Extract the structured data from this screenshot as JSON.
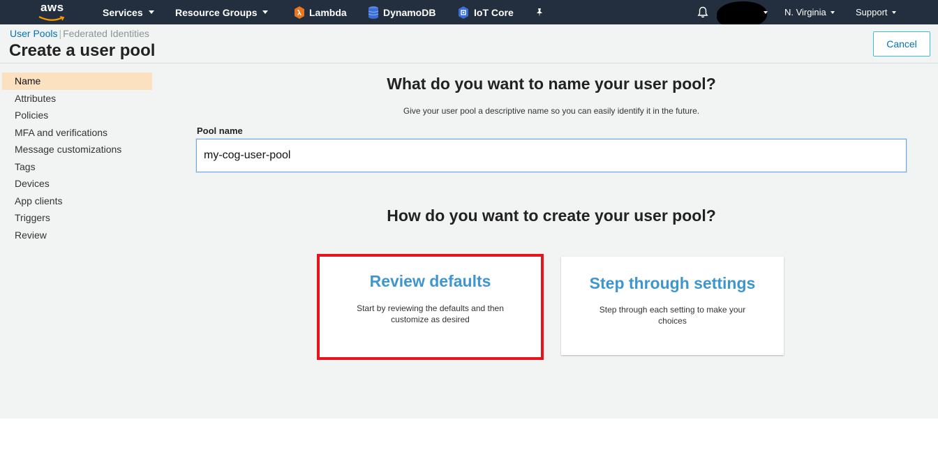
{
  "topnav": {
    "logo_text": "aws",
    "services": "Services",
    "resource_groups": "Resource Groups",
    "shortcuts": [
      {
        "label": "Lambda",
        "icon": "lambda-icon",
        "color": "#e7761f"
      },
      {
        "label": "DynamoDB",
        "icon": "dynamodb-icon",
        "color": "#3b6fd6"
      },
      {
        "label": "IoT Core",
        "icon": "iot-core-icon",
        "color": "#3b6fd6"
      }
    ],
    "region": "N. Virginia",
    "support": "Support"
  },
  "breadcrumb": {
    "active": "User Pools",
    "other": "Federated Identities"
  },
  "page_title": "Create a user pool",
  "cancel_label": "Cancel",
  "sidenav": {
    "items": [
      {
        "label": "Name",
        "selected": true
      },
      {
        "label": "Attributes"
      },
      {
        "label": "Policies"
      },
      {
        "label": "MFA and verifications"
      },
      {
        "label": "Message customizations"
      },
      {
        "label": "Tags"
      },
      {
        "label": "Devices"
      },
      {
        "label": "App clients"
      },
      {
        "label": "Triggers"
      },
      {
        "label": "Review"
      }
    ]
  },
  "name_section": {
    "heading": "What do you want to name your user pool?",
    "description": "Give your user pool a descriptive name so you can easily identify it in the future.",
    "field_label": "Pool name",
    "field_value": "my-cog-user-pool"
  },
  "create_section": {
    "heading": "How do you want to create your user pool?",
    "options": [
      {
        "title": "Review defaults",
        "description": "Start by reviewing the defaults and then customize as desired"
      },
      {
        "title": "Step through settings",
        "description": "Step through each setting to make your choices"
      }
    ]
  },
  "colors": {
    "nav_bg": "#232f3e",
    "page_bg": "#f2f3f3",
    "selected_nav": "#fbe1c0",
    "link_blue": "#0073bb",
    "card_title_blue": "#3e96cf",
    "highlight_red": "#e8141c"
  }
}
